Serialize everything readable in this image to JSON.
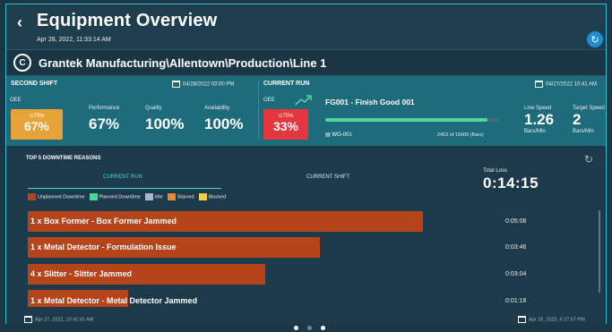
{
  "header": {
    "title": "Equipment Overview",
    "datetime": "Apr 28, 2022, 11:33:14 AM"
  },
  "location": "Grantek Manufacturing\\Allentown\\Production\\Line 1",
  "second_shift": {
    "title": "SECOND SHIFT",
    "date": "04/28/2022 03:00 PM",
    "oee_label": "OEE",
    "oee_target": "⊙75%",
    "oee_value": "67%",
    "metrics": [
      {
        "label": "Performance",
        "value": "67%"
      },
      {
        "label": "Quality",
        "value": "100%"
      },
      {
        "label": "Availability",
        "value": "100%"
      }
    ]
  },
  "current_run": {
    "title": "CURRENT RUN",
    "date": "04/27/2022 10:41 AM",
    "oee_label": "OEE",
    "oee_target": "⊙75%",
    "oee_value": "33%",
    "product": "FG001 - Finish Good 001",
    "work_order": "WO-001",
    "progress_text": "2403 of 15000 (Bars)",
    "progress_fraction": 0.94,
    "line_speed": {
      "label": "Line Speed",
      "value": "1.26",
      "unit": "Bars/Min"
    },
    "target_speed": {
      "label": "Target Speed",
      "value": "2",
      "unit": "Bars/Min"
    }
  },
  "downtime": {
    "title": "TOP 5 DOWNTIME REASONS",
    "tabs": [
      "CURRENT RUN",
      "CURRENT SHIFT"
    ],
    "total_loss_label": "Total Loss",
    "total_loss": "0:14:15",
    "legend": [
      {
        "label": "Unplanned Downtime",
        "color": "#b5441b"
      },
      {
        "label": "Planned Downtime",
        "color": "#4fd69c"
      },
      {
        "label": "Idle",
        "color": "#a9b5c8"
      },
      {
        "label": "Starved",
        "color": "#e88a2c"
      },
      {
        "label": "Blocked",
        "color": "#f0d04a"
      }
    ],
    "reasons": [
      {
        "label": "1 x Box Former - Box Former Jammed",
        "duration": "0:05:06",
        "fraction": 0.989
      },
      {
        "label": "1 x Metal Detector - Formulation Issue",
        "duration": "0:03:46",
        "fraction": 0.731
      },
      {
        "label": "4 x Slitter - Slitter Jammed",
        "duration": "0:03:04",
        "fraction": 0.595
      },
      {
        "label": "1 x Metal Detector - Metal Detector Jammed",
        "duration": "0:01:18",
        "fraction": 0.25
      }
    ],
    "footer_left": "Apr 27, 2022, 10:41:41 AM",
    "footer_right": "Apr 28, 2022, 6:27:57 PM"
  },
  "colors": {
    "bg": "#1e3d4d",
    "accent": "#39bcd6",
    "oee_warn": "#e8a23a",
    "oee_bad": "#e4363f",
    "bar": "#b5441b"
  }
}
